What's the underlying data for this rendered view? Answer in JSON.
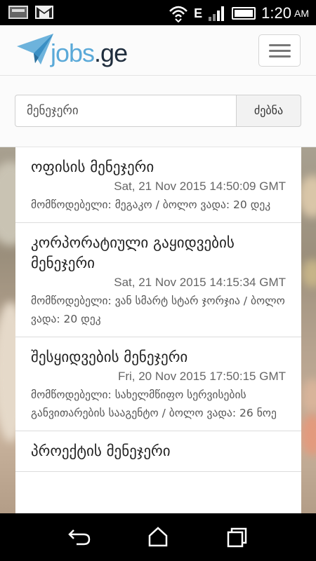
{
  "status_bar": {
    "time": "1:20",
    "ampm": "AM",
    "network": "E",
    "icons": [
      "image-icon",
      "gmail-icon",
      "wifi-icon",
      "signal-icon",
      "battery-icon"
    ]
  },
  "header": {
    "logo_jobs": "jobs",
    "logo_ge": ".ge",
    "logo_colors": {
      "jobs": "#5aa9d8",
      "ge": "#1f2d3d"
    }
  },
  "search": {
    "value": "მენეჯერი",
    "button_label": "ძებნა"
  },
  "jobs": [
    {
      "title": "ოფისის მენეჯერი",
      "date": "Sat, 21 Nov 2015 14:50:09 GMT",
      "meta": "მომწოდებელი: მეგაკო / ბოლო ვადა: 20 დეკ"
    },
    {
      "title": "კორპორატიული გაყიდვების მენეჯერი",
      "date": "Sat, 21 Nov 2015 14:15:34 GMT",
      "meta": "მომწოდებელი: ვან სმარტ სტარ ჯორჯია / ბოლო ვადა: 20 დეკ"
    },
    {
      "title": "შესყიდვების მენეჯერი",
      "date": "Fri, 20 Nov 2015 17:50:15 GMT",
      "meta": "მომწოდებელი: სახელმწიფო სერვისების განვითარების სააგენტო / ბოლო ვადა: 26 ნოე"
    },
    {
      "title": "პროექტის მენეჯერი",
      "date": "",
      "meta": ""
    }
  ],
  "nav": {
    "icons": [
      "back-icon",
      "home-icon",
      "recent-apps-icon"
    ]
  }
}
